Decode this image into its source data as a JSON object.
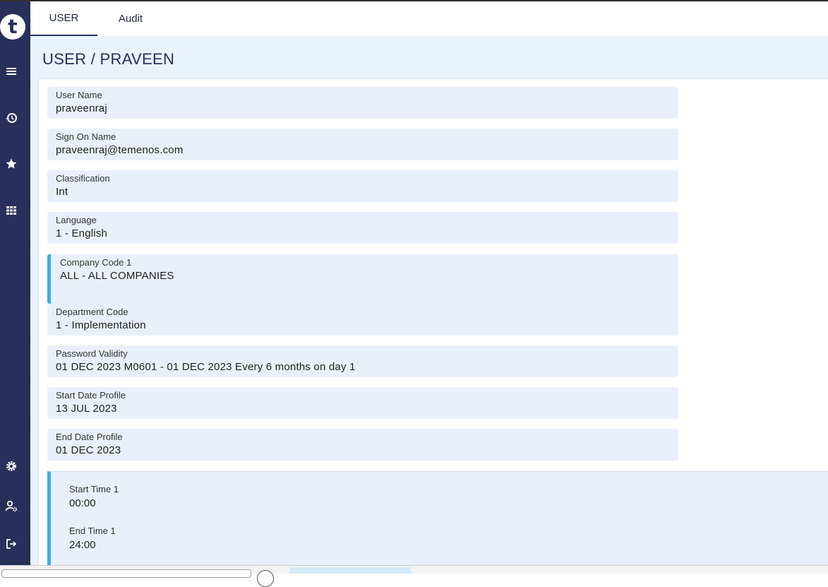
{
  "app": {
    "logo_letter": "t"
  },
  "sidebar": {
    "icons": [
      "menu-icon",
      "history-icon",
      "star-icon",
      "grid-icon",
      "settings-icon",
      "user-settings-icon",
      "logout-icon"
    ]
  },
  "tabs": [
    {
      "label": "USER",
      "active": true
    },
    {
      "label": "Audit",
      "active": false
    }
  ],
  "page": {
    "title": "USER / PRAVEEN"
  },
  "fields": [
    {
      "label": "User Name",
      "value": "praveenraj"
    },
    {
      "label": "Sign On Name",
      "value": "praveenraj@temenos.com"
    },
    {
      "label": "Classification",
      "value": "Int"
    },
    {
      "label": "Language",
      "value": "1 - English"
    },
    {
      "label": "Company Code 1",
      "value": "ALL - ALL COMPANIES"
    },
    {
      "label": "Department Code",
      "value": "1 - Implementation"
    },
    {
      "label": "Password Validity",
      "value": "01 DEC 2023 M0601 - 01 DEC 2023 Every 6 months on day 1"
    },
    {
      "label": "Start Date Profile",
      "value": "13 JUL 2023"
    },
    {
      "label": "End Date Profile",
      "value": "01 DEC 2023"
    }
  ],
  "time_group": [
    {
      "label": "Start Time 1",
      "value": "00:00"
    },
    {
      "label": "End Time 1",
      "value": "24:00"
    }
  ],
  "colors": {
    "sidebar": "#27305a",
    "accent": "#3bb0e5",
    "field_bg": "#eaf0fb",
    "content_bg": "#eaf2fc"
  }
}
